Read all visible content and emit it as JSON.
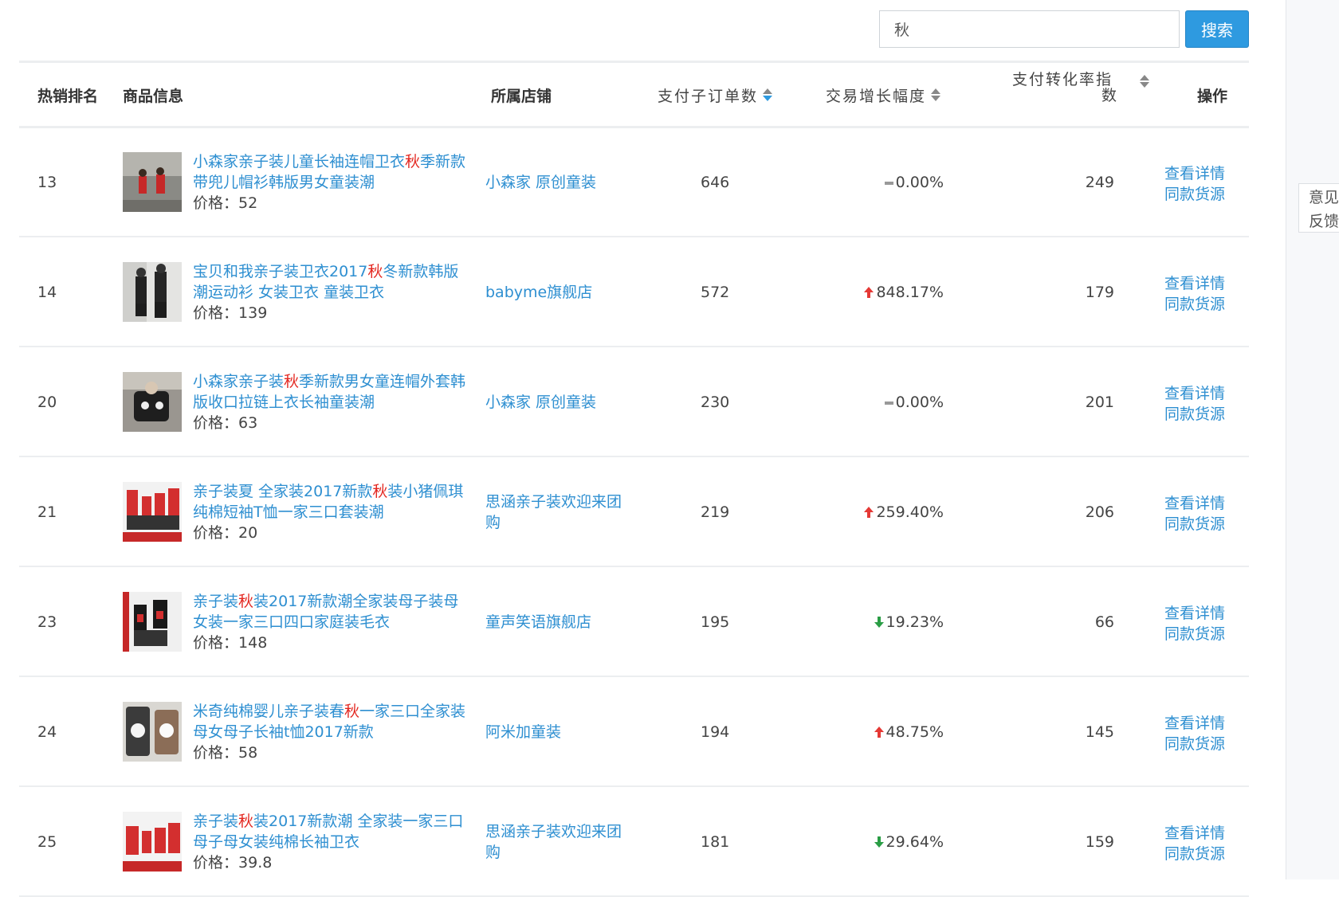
{
  "search": {
    "value": "秋",
    "button_label": "搜索"
  },
  "feedback": {
    "line1": "意见",
    "line2": "反馈"
  },
  "columns": {
    "rank": "热销排名",
    "product": "商品信息",
    "shop": "所属店铺",
    "orders": "支付子订单数",
    "growth": "交易增长幅度",
    "conversion_line1": "支付转化率指",
    "conversion_line2": "数",
    "ops": "操作"
  },
  "price_label": "价格：",
  "action_labels": {
    "detail": "查看详情",
    "same": "同款货源"
  },
  "colors": {
    "link": "#2e8fd1",
    "highlight": "#e3261f",
    "up": "#e53935",
    "down": "#2a9d45",
    "button": "#2e9ae0"
  },
  "rows": [
    {
      "rank": "13",
      "title_pre": "小森家亲子装儿童长袖连帽卫衣",
      "title_hl": "秋",
      "title_post": "季新款带兜儿帽衫韩版男女童装潮",
      "price": "52",
      "shop": "小森家 原创童装",
      "orders": "646",
      "growth": "0.00%",
      "trend": "flat",
      "conversion": "249"
    },
    {
      "rank": "14",
      "title_pre": "宝贝和我亲子装卫衣2017",
      "title_hl": "秋",
      "title_post": "冬新款韩版潮运动衫 女装卫衣 童装卫衣",
      "price": "139",
      "shop": "babyme旗舰店",
      "orders": "572",
      "growth": "848.17%",
      "trend": "up",
      "conversion": "179"
    },
    {
      "rank": "20",
      "title_pre": "小森家亲子装",
      "title_hl": "秋",
      "title_post": "季新款男女童连帽外套韩版收口拉链上衣长袖童装潮",
      "price": "63",
      "shop": "小森家 原创童装",
      "orders": "230",
      "growth": "0.00%",
      "trend": "flat",
      "conversion": "201"
    },
    {
      "rank": "21",
      "title_pre": "亲子装夏 全家装2017新款",
      "title_hl": "秋",
      "title_post": "装小猪佩琪纯棉短袖T恤一家三口套装潮",
      "price": "20",
      "shop": "思涵亲子装欢迎来团购",
      "orders": "219",
      "growth": "259.40%",
      "trend": "up",
      "conversion": "206"
    },
    {
      "rank": "23",
      "title_pre": "亲子装",
      "title_hl": "秋",
      "title_post": "装2017新款潮全家装母子装母女装一家三口四口家庭装毛衣",
      "price": "148",
      "shop": "童声笑语旗舰店",
      "orders": "195",
      "growth": "19.23%",
      "trend": "down",
      "conversion": "66"
    },
    {
      "rank": "24",
      "title_pre": "米奇纯棉婴儿亲子装春",
      "title_hl": "秋",
      "title_post": "一家三口全家装母女母子长袖t恤2017新款",
      "price": "58",
      "shop": "阿米加童装",
      "orders": "194",
      "growth": "48.75%",
      "trend": "up",
      "conversion": "145"
    },
    {
      "rank": "25",
      "title_pre": "亲子装",
      "title_hl": "秋",
      "title_post": "装2017新款潮 全家装一家三口母子母女装纯棉长袖卫衣",
      "price": "39.8",
      "shop": "思涵亲子装欢迎来团购",
      "orders": "181",
      "growth": "29.64%",
      "trend": "down",
      "conversion": "159"
    }
  ]
}
